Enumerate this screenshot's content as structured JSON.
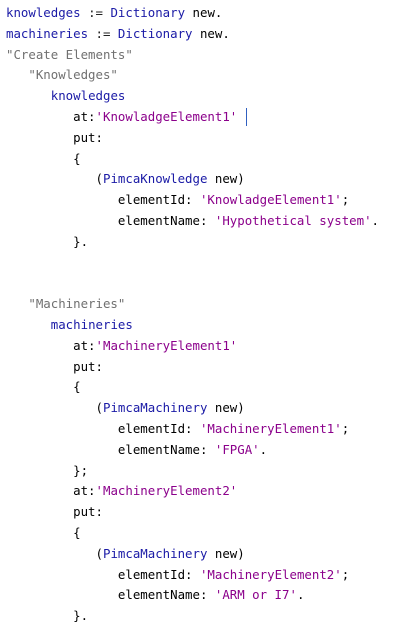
{
  "editor": {
    "lines": [
      [
        {
          "t": "knowledges",
          "k": "var"
        },
        {
          "t": " := ",
          "k": "op"
        },
        {
          "t": "Dictionary",
          "k": "cls"
        },
        {
          "t": " new.",
          "k": "msg"
        }
      ],
      [
        {
          "t": "machineries",
          "k": "var"
        },
        {
          "t": " := ",
          "k": "op"
        },
        {
          "t": "Dictionary",
          "k": "cls"
        },
        {
          "t": " new.",
          "k": "msg"
        }
      ],
      [
        {
          "t": "\"Create Elements\"",
          "k": "cmt"
        }
      ],
      [
        {
          "t": "   \"Knowledges\"",
          "k": "cmt"
        }
      ],
      [
        {
          "t": "      ",
          "k": "msg"
        },
        {
          "t": "knowledges",
          "k": "id"
        }
      ],
      [
        {
          "t": "         at:",
          "k": "kw"
        },
        {
          "t": "'KnowladgeElement1'",
          "k": "str"
        },
        {
          "t": "",
          "k": "caret"
        }
      ],
      [
        {
          "t": "         put:",
          "k": "kw"
        }
      ],
      [
        {
          "t": "         {",
          "k": "punc"
        }
      ],
      [
        {
          "t": "            (",
          "k": "punc"
        },
        {
          "t": "PimcaKnowledge",
          "k": "cls"
        },
        {
          "t": " new)",
          "k": "msg"
        }
      ],
      [
        {
          "t": "               elementId: ",
          "k": "kw"
        },
        {
          "t": "'KnowladgeElement1'",
          "k": "str"
        },
        {
          "t": ";",
          "k": "punc"
        }
      ],
      [
        {
          "t": "               elementName: ",
          "k": "kw"
        },
        {
          "t": "'Hypothetical system'",
          "k": "str"
        },
        {
          "t": ".",
          "k": "punc"
        }
      ],
      [
        {
          "t": "         }.",
          "k": "punc"
        }
      ],
      [],
      [],
      [
        {
          "t": "   \"Machineries\"",
          "k": "cmt"
        }
      ],
      [
        {
          "t": "      ",
          "k": "msg"
        },
        {
          "t": "machineries",
          "k": "id"
        }
      ],
      [
        {
          "t": "         at:",
          "k": "kw"
        },
        {
          "t": "'MachineryElement1'",
          "k": "str"
        }
      ],
      [
        {
          "t": "         put:",
          "k": "kw"
        }
      ],
      [
        {
          "t": "         {",
          "k": "punc"
        }
      ],
      [
        {
          "t": "            (",
          "k": "punc"
        },
        {
          "t": "PimcaMachinery",
          "k": "cls"
        },
        {
          "t": " new)",
          "k": "msg"
        }
      ],
      [
        {
          "t": "               elementId: ",
          "k": "kw"
        },
        {
          "t": "'MachineryElement1'",
          "k": "str"
        },
        {
          "t": ";",
          "k": "punc"
        }
      ],
      [
        {
          "t": "               elementName: ",
          "k": "kw"
        },
        {
          "t": "'FPGA'",
          "k": "str"
        },
        {
          "t": ".",
          "k": "punc"
        }
      ],
      [
        {
          "t": "         };",
          "k": "punc"
        }
      ],
      [
        {
          "t": "         at:",
          "k": "kw"
        },
        {
          "t": "'MachineryElement2'",
          "k": "str"
        }
      ],
      [
        {
          "t": "         put:",
          "k": "kw"
        }
      ],
      [
        {
          "t": "         {",
          "k": "punc"
        }
      ],
      [
        {
          "t": "            (",
          "k": "punc"
        },
        {
          "t": "PimcaMachinery",
          "k": "cls"
        },
        {
          "t": " new)",
          "k": "msg"
        }
      ],
      [
        {
          "t": "               elementId: ",
          "k": "kw"
        },
        {
          "t": "'MachineryElement2'",
          "k": "str"
        },
        {
          "t": ";",
          "k": "punc"
        }
      ],
      [
        {
          "t": "               elementName: ",
          "k": "kw"
        },
        {
          "t": "'ARM or I7'",
          "k": "str"
        },
        {
          "t": ".",
          "k": "punc"
        }
      ],
      [
        {
          "t": "         }.",
          "k": "punc"
        }
      ]
    ]
  }
}
